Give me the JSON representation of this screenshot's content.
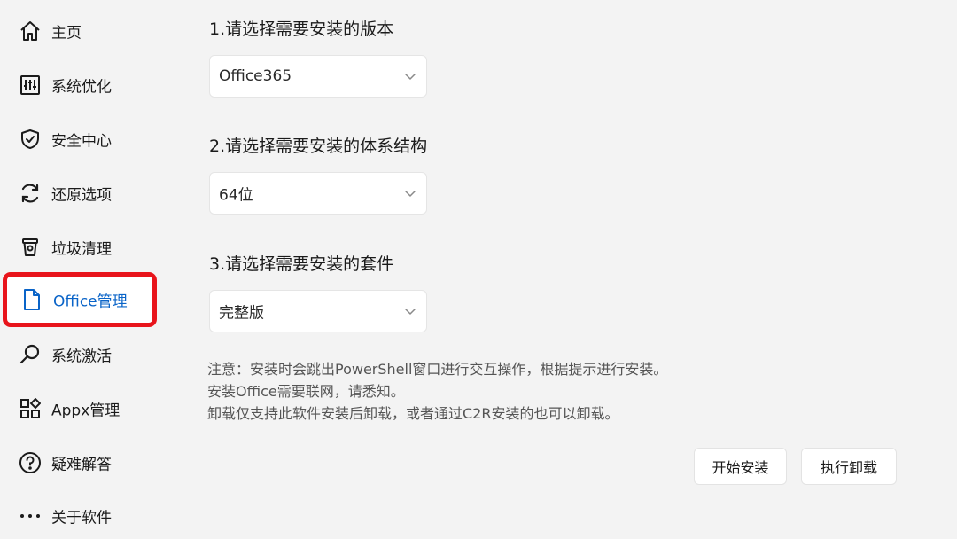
{
  "sidebar": {
    "items": [
      {
        "label": "主页",
        "icon": "home-icon"
      },
      {
        "label": "系统优化",
        "icon": "sliders-icon"
      },
      {
        "label": "安全中心",
        "icon": "shield-icon"
      },
      {
        "label": "还原选项",
        "icon": "refresh-icon"
      },
      {
        "label": "垃圾清理",
        "icon": "trash-icon"
      },
      {
        "label": "Office管理",
        "icon": "document-icon",
        "active": true
      },
      {
        "label": "系统激活",
        "icon": "search-key-icon"
      },
      {
        "label": "Appx管理",
        "icon": "apps-grid-icon"
      },
      {
        "label": "疑难解答",
        "icon": "help-circle-icon"
      },
      {
        "label": "关于软件",
        "icon": "more-dots-icon"
      }
    ]
  },
  "main": {
    "version": {
      "title": "1.请选择需要安装的版本",
      "selected": "Office365"
    },
    "architecture": {
      "title": "2.请选择需要安装的体系结构",
      "selected": "64位"
    },
    "suite": {
      "title": "3.请选择需要安装的套件",
      "selected": "完整版"
    },
    "notes": [
      "注意：安装时会跳出PowerShell窗口进行交互操作，根据提示进行安装。",
      "安装Office需要联网，请悉知。",
      "卸载仅支持此软件安装后卸载，或者通过C2R安装的也可以卸载。"
    ],
    "buttons": {
      "install": "开始安装",
      "uninstall": "执行卸载"
    }
  },
  "colors": {
    "accent": "#0a64c8",
    "highlight_border": "#e8141b",
    "background": "#f3f3f3"
  }
}
